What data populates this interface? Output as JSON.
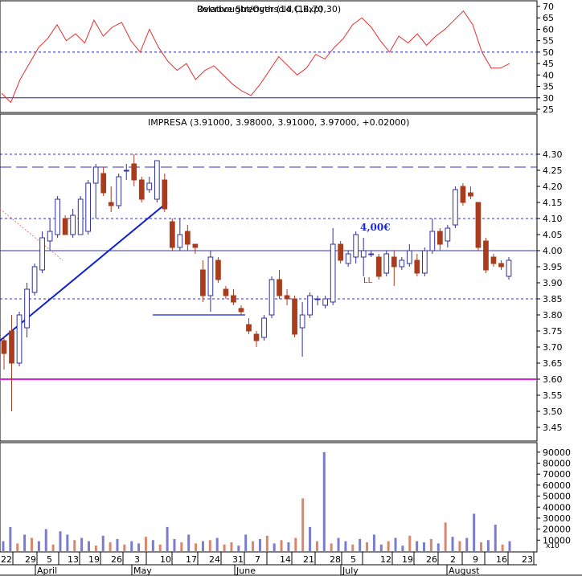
{
  "chart_data": [
    {
      "type": "line",
      "panel": "rsi",
      "title": "Relative Strength (14,C,Exp)",
      "title_overlap_text": "Overbought/Oversold (14,70,30)",
      "ylim": [
        25,
        70
      ],
      "y_ticks": [
        25,
        30,
        35,
        40,
        45,
        50,
        55,
        60,
        65,
        70
      ],
      "levels": [
        30,
        50
      ],
      "line_color": "#e03030",
      "series": [
        {
          "values": [
            32,
            28,
            38,
            45,
            52,
            56,
            62,
            55,
            58,
            54,
            64,
            57,
            61,
            63,
            55,
            50,
            60,
            52,
            46,
            42,
            45,
            38,
            42,
            44,
            40,
            36,
            33,
            31,
            36,
            42,
            48,
            44,
            40,
            43,
            49,
            47,
            52,
            56,
            62,
            65,
            61,
            55,
            50,
            57,
            54,
            58,
            53,
            57,
            60,
            64,
            68,
            62,
            50,
            43,
            43,
            45
          ]
        }
      ]
    },
    {
      "type": "candlestick",
      "panel": "price",
      "title": "IMPRESA (3.91000, 3.98000, 3.91000, 3.97000, +0.02000)",
      "ylim": [
        3.43,
        4.34
      ],
      "y_ticks": [
        3.45,
        3.5,
        3.55,
        3.6,
        3.65,
        3.7,
        3.75,
        3.8,
        3.85,
        3.9,
        3.95,
        4.0,
        4.05,
        4.1,
        4.15,
        4.2,
        4.25,
        4.3
      ],
      "annotation_label": "4,00€",
      "annotation_label_value": 4.0,
      "annotation_marker": "LL",
      "horizontal_levels": [
        {
          "value": 4.3,
          "style": "dashed",
          "color": "#3030c0"
        },
        {
          "value": 4.26,
          "style": "long-dash",
          "color": "#3030c0"
        },
        {
          "value": 4.1,
          "style": "dashed",
          "color": "#3030c0"
        },
        {
          "value": 4.0,
          "style": "solid",
          "color": "#3030c0"
        },
        {
          "value": 3.85,
          "style": "dashed",
          "color": "#3030c0"
        },
        {
          "value": 3.6,
          "style": "solid",
          "color": "#e020e0"
        }
      ],
      "trendline_color": "#1020d0",
      "up_color": "#ffffff",
      "down_color": "#a83c1c",
      "candles": [
        {
          "o": 3.72,
          "h": 3.73,
          "l": 3.63,
          "c": 3.68
        },
        {
          "o": 3.75,
          "h": 3.8,
          "l": 3.5,
          "c": 3.65
        },
        {
          "o": 3.65,
          "h": 3.81,
          "l": 3.64,
          "c": 3.8
        },
        {
          "o": 3.76,
          "h": 3.9,
          "l": 3.73,
          "c": 3.88
        },
        {
          "o": 3.87,
          "h": 3.96,
          "l": 3.86,
          "c": 3.95
        },
        {
          "o": 3.94,
          "h": 4.06,
          "l": 3.93,
          "c": 4.04
        },
        {
          "o": 4.03,
          "h": 4.1,
          "l": 4.0,
          "c": 4.06
        },
        {
          "o": 4.05,
          "h": 4.17,
          "l": 4.04,
          "c": 4.16
        },
        {
          "o": 4.1,
          "h": 4.11,
          "l": 4.05,
          "c": 4.05
        },
        {
          "o": 4.05,
          "h": 4.13,
          "l": 4.04,
          "c": 4.11
        },
        {
          "o": 4.05,
          "h": 4.17,
          "l": 4.05,
          "c": 4.16
        },
        {
          "o": 4.06,
          "h": 4.22,
          "l": 4.05,
          "c": 4.21
        },
        {
          "o": 4.21,
          "h": 4.27,
          "l": 4.1,
          "c": 4.26
        },
        {
          "o": 4.24,
          "h": 4.26,
          "l": 4.17,
          "c": 4.18
        },
        {
          "o": 4.15,
          "h": 4.2,
          "l": 4.12,
          "c": 4.14
        },
        {
          "o": 4.14,
          "h": 4.24,
          "l": 4.13,
          "c": 4.23
        },
        {
          "o": 4.25,
          "h": 4.27,
          "l": 4.22,
          "c": 4.25
        },
        {
          "o": 4.27,
          "h": 4.3,
          "l": 4.2,
          "c": 4.22
        },
        {
          "o": 4.22,
          "h": 4.23,
          "l": 4.15,
          "c": 4.16
        },
        {
          "o": 4.19,
          "h": 4.23,
          "l": 4.18,
          "c": 4.21
        },
        {
          "o": 4.16,
          "h": 4.28,
          "l": 4.15,
          "c": 4.28
        },
        {
          "o": 4.22,
          "h": 4.24,
          "l": 4.12,
          "c": 4.13
        },
        {
          "o": 4.09,
          "h": 4.1,
          "l": 4.0,
          "c": 4.01
        },
        {
          "o": 4.01,
          "h": 4.1,
          "l": 4.0,
          "c": 4.05
        },
        {
          "o": 4.06,
          "h": 4.08,
          "l": 4.0,
          "c": 4.02
        },
        {
          "o": 4.02,
          "h": 4.02,
          "l": 3.99,
          "c": 4.01
        },
        {
          "o": 3.94,
          "h": 3.97,
          "l": 3.84,
          "c": 3.86
        },
        {
          "o": 3.86,
          "h": 4.0,
          "l": 3.81,
          "c": 3.98
        },
        {
          "o": 3.97,
          "h": 3.98,
          "l": 3.9,
          "c": 3.91
        },
        {
          "o": 3.88,
          "h": 3.89,
          "l": 3.85,
          "c": 3.86
        },
        {
          "o": 3.86,
          "h": 3.88,
          "l": 3.83,
          "c": 3.84
        },
        {
          "o": 3.82,
          "h": 3.83,
          "l": 3.8,
          "c": 3.81
        },
        {
          "o": 3.77,
          "h": 3.79,
          "l": 3.74,
          "c": 3.75
        },
        {
          "o": 3.74,
          "h": 3.75,
          "l": 3.7,
          "c": 3.72
        },
        {
          "o": 3.73,
          "h": 3.8,
          "l": 3.72,
          "c": 3.79
        },
        {
          "o": 3.8,
          "h": 3.92,
          "l": 3.79,
          "c": 3.91
        },
        {
          "o": 3.91,
          "h": 3.94,
          "l": 3.85,
          "c": 3.86
        },
        {
          "o": 3.86,
          "h": 3.88,
          "l": 3.83,
          "c": 3.85
        },
        {
          "o": 3.85,
          "h": 3.86,
          "l": 3.73,
          "c": 3.74
        },
        {
          "o": 3.76,
          "h": 3.84,
          "l": 3.67,
          "c": 3.8
        },
        {
          "o": 3.8,
          "h": 3.87,
          "l": 3.79,
          "c": 3.86
        },
        {
          "o": 3.85,
          "h": 3.86,
          "l": 3.83,
          "c": 3.85
        },
        {
          "o": 3.83,
          "h": 3.86,
          "l": 3.82,
          "c": 3.85
        },
        {
          "o": 3.84,
          "h": 4.07,
          "l": 3.83,
          "c": 4.02
        },
        {
          "o": 4.02,
          "h": 4.03,
          "l": 3.96,
          "c": 3.97
        },
        {
          "o": 3.96,
          "h": 4.0,
          "l": 3.95,
          "c": 3.99
        },
        {
          "o": 3.98,
          "h": 4.06,
          "l": 3.96,
          "c": 4.05
        },
        {
          "o": 3.98,
          "h": 4.04,
          "l": 3.92,
          "c": 4.0
        },
        {
          "o": 3.99,
          "h": 4.0,
          "l": 3.98,
          "c": 3.99
        },
        {
          "o": 3.98,
          "h": 3.99,
          "l": 3.91,
          "c": 3.92
        },
        {
          "o": 3.93,
          "h": 4.0,
          "l": 3.92,
          "c": 3.99
        },
        {
          "o": 3.98,
          "h": 4.0,
          "l": 3.89,
          "c": 3.95
        },
        {
          "o": 3.95,
          "h": 3.98,
          "l": 3.94,
          "c": 3.97
        },
        {
          "o": 3.96,
          "h": 4.02,
          "l": 3.95,
          "c": 4.0
        },
        {
          "o": 3.97,
          "h": 3.99,
          "l": 3.92,
          "c": 3.93
        },
        {
          "o": 3.93,
          "h": 4.01,
          "l": 3.92,
          "c": 4.0
        },
        {
          "o": 4.0,
          "h": 4.1,
          "l": 3.99,
          "c": 4.06
        },
        {
          "o": 4.06,
          "h": 4.07,
          "l": 4.0,
          "c": 4.02
        },
        {
          "o": 4.03,
          "h": 4.08,
          "l": 4.01,
          "c": 4.07
        },
        {
          "o": 4.08,
          "h": 4.2,
          "l": 4.07,
          "c": 4.19
        },
        {
          "o": 4.2,
          "h": 4.21,
          "l": 4.14,
          "c": 4.15
        },
        {
          "o": 4.18,
          "h": 4.2,
          "l": 4.16,
          "c": 4.17
        },
        {
          "o": 4.15,
          "h": 4.15,
          "l": 4.0,
          "c": 4.01
        },
        {
          "o": 4.03,
          "h": 4.04,
          "l": 3.93,
          "c": 3.94
        },
        {
          "o": 3.98,
          "h": 3.99,
          "l": 3.95,
          "c": 3.96
        },
        {
          "o": 3.96,
          "h": 3.97,
          "l": 3.94,
          "c": 3.95
        },
        {
          "o": 3.92,
          "h": 3.98,
          "l": 3.91,
          "c": 3.97
        }
      ]
    },
    {
      "type": "bar",
      "panel": "volume",
      "ylim": [
        0,
        95000
      ],
      "y_ticks": [
        10000,
        20000,
        30000,
        40000,
        50000,
        60000,
        70000,
        80000,
        90000
      ],
      "unit_label": "x10",
      "up_color": "#7b7bd0",
      "down_color": "#d9876b",
      "values": [
        9000,
        22000,
        7000,
        15000,
        12000,
        9000,
        20000,
        6000,
        18000,
        15000,
        10000,
        12000,
        9000,
        5000,
        14000,
        8000,
        11000,
        6000,
        9000,
        7000,
        13000,
        10000,
        6000,
        22000,
        11000,
        8000,
        15000,
        7000,
        9000,
        10000,
        12000,
        6000,
        8000,
        5000,
        15000,
        9000,
        11000,
        14000,
        7000,
        10000,
        8000,
        12000,
        48000,
        22000,
        9000,
        90000,
        7000,
        12000,
        9000,
        6000,
        11000,
        8000,
        15000,
        6000,
        9000,
        12000,
        5000,
        14000,
        9000,
        8000,
        11000,
        7000,
        26000,
        13000,
        9000,
        12000,
        34000,
        8000,
        10000,
        24000,
        6000,
        9000
      ],
      "up": [
        1,
        1,
        0,
        1,
        0,
        1,
        1,
        0,
        1,
        1,
        0,
        1,
        1,
        0,
        1,
        0,
        1,
        0,
        1,
        1,
        0,
        1,
        0,
        1,
        1,
        0,
        1,
        0,
        1,
        0,
        1,
        0,
        0,
        1,
        1,
        0,
        1,
        0,
        1,
        0,
        1,
        0,
        0,
        1,
        0,
        1,
        0,
        1,
        1,
        0,
        1,
        0,
        1,
        1,
        0,
        1,
        1,
        0,
        1,
        1,
        0,
        1,
        0,
        1,
        0,
        1,
        1,
        0,
        1,
        1,
        0,
        1
      ]
    }
  ],
  "x_axis": {
    "day_labels": [
      "22",
      "29",
      "5",
      "13",
      "19",
      "26",
      "3",
      "10",
      "17",
      "24",
      "31",
      "7",
      "14",
      "21",
      "28",
      "5",
      "12",
      "19",
      "26",
      "2",
      "9",
      "16",
      "23"
    ],
    "month_labels": [
      "April",
      "May",
      "June",
      "July",
      "August"
    ]
  }
}
